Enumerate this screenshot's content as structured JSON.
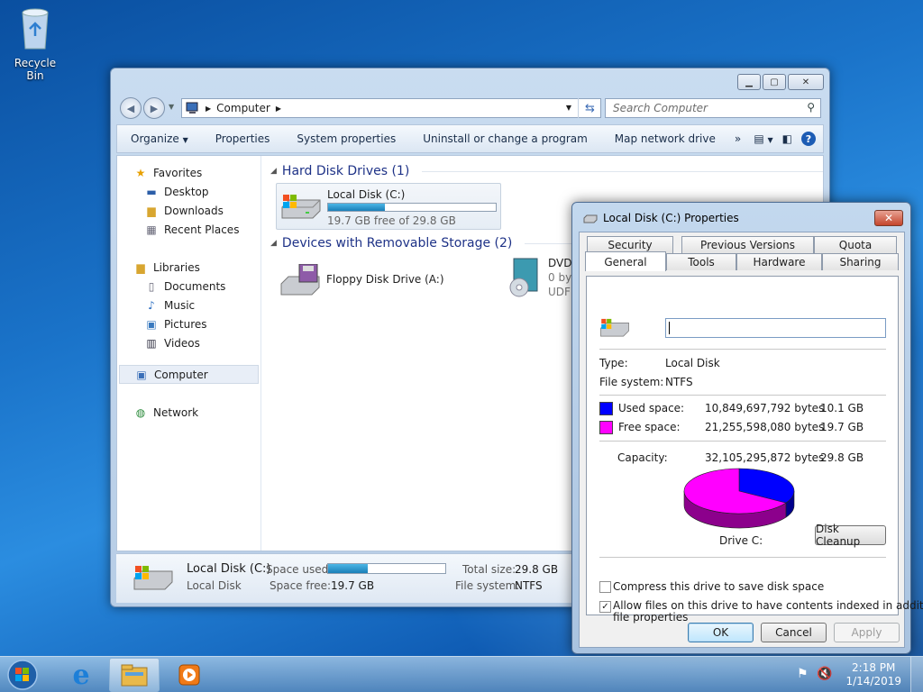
{
  "desktop": {
    "recycle_bin": "Recycle Bin"
  },
  "explorer": {
    "address": {
      "crumb": "Computer"
    },
    "search": {
      "placeholder": "Search Computer"
    },
    "toolbar": {
      "organize": "Organize",
      "properties": "Properties",
      "system_properties": "System properties",
      "uninstall": "Uninstall or change a program",
      "map_drive": "Map network drive",
      "more": "»"
    },
    "nav": {
      "favorites": "Favorites",
      "desktop": "Desktop",
      "downloads": "Downloads",
      "recent": "Recent Places",
      "libraries": "Libraries",
      "documents": "Documents",
      "music": "Music",
      "pictures": "Pictures",
      "videos": "Videos",
      "computer": "Computer",
      "network": "Network"
    },
    "groups": {
      "hdd": "Hard Disk Drives (1)",
      "removable": "Devices with Removable Storage (2)"
    },
    "local_disk": {
      "name": "Local Disk (C:)",
      "free": "19.7 GB free of 29.8 GB",
      "used_fraction": 0.34
    },
    "floppy": {
      "name": "Floppy Disk Drive (A:)"
    },
    "dvd": {
      "name": "DVD",
      "line2": "0 by",
      "line3": "UDF"
    },
    "details": {
      "name": "Local Disk (C:)",
      "type": "Local Disk",
      "space_used_label": "Space used:",
      "space_free_label": "Space free:",
      "space_free": "19.7 GB",
      "total_size_label": "Total size:",
      "total_size": "29.8 GB",
      "fs_label": "File system:",
      "fs": "NTFS",
      "used_fraction": 0.34
    }
  },
  "dialog": {
    "title": "Local Disk (C:) Properties",
    "tabs": {
      "security": "Security",
      "previous": "Previous Versions",
      "quota": "Quota",
      "general": "General",
      "tools": "Tools",
      "hardware": "Hardware",
      "sharing": "Sharing"
    },
    "name_value": "",
    "type_label": "Type:",
    "type_value": "Local Disk",
    "fs_label": "File system:",
    "fs_value": "NTFS",
    "used_label": "Used space:",
    "used_bytes": "10,849,697,792 bytes",
    "used_gb": "10.1 GB",
    "free_label": "Free space:",
    "free_bytes": "21,255,598,080 bytes",
    "free_gb": "19.7 GB",
    "capacity_label": "Capacity:",
    "capacity_bytes": "32,105,295,872 bytes",
    "capacity_gb": "29.8 GB",
    "drive_label": "Drive C:",
    "disk_cleanup": "Disk Cleanup",
    "compress_label": "Compress this drive to save disk space",
    "compress_checked": false,
    "index_label_1": "Allow files on this drive to have contents indexed in addition to",
    "index_label_2": "file properties",
    "index_checked": true,
    "ok": "OK",
    "cancel": "Cancel",
    "apply": "Apply",
    "colors": {
      "used": "#0000ff",
      "free": "#ff00ff"
    }
  },
  "taskbar": {
    "time": "2:18 PM",
    "date": "1/14/2019"
  },
  "chart_data": {
    "type": "pie",
    "categories": [
      "Used space",
      "Free space"
    ],
    "values": [
      10849697792,
      21255598080
    ],
    "colors": [
      "#0000ff",
      "#ff00ff"
    ],
    "title": "",
    "xlabel": "",
    "ylabel": ""
  }
}
